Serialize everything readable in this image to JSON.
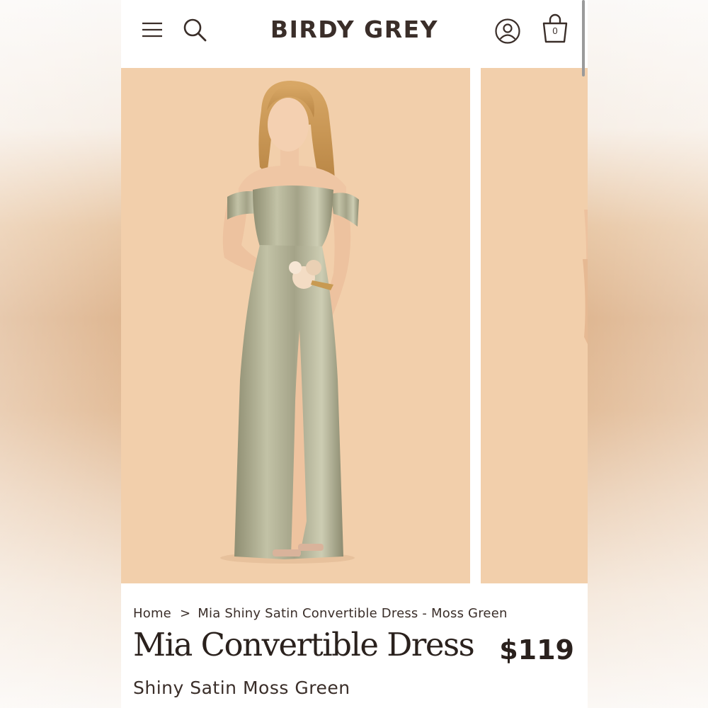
{
  "header": {
    "logo": "BIRDY GREY",
    "cart_count": "0"
  },
  "icons": {
    "menu": "hamburger-icon",
    "search": "search-icon",
    "account": "user-circle-icon",
    "cart": "shopping-bag-icon"
  },
  "breadcrumb": {
    "home": "Home",
    "separator": ">",
    "current": "Mia Shiny Satin Convertible Dress - Moss Green"
  },
  "product": {
    "title": "Mia Convertible Dress",
    "price": "$119",
    "variant": "Shiny Satin Moss Green"
  },
  "colors": {
    "photo_background": "#f2cfab",
    "dress": "#a9a88c",
    "text": "#2a211d"
  }
}
